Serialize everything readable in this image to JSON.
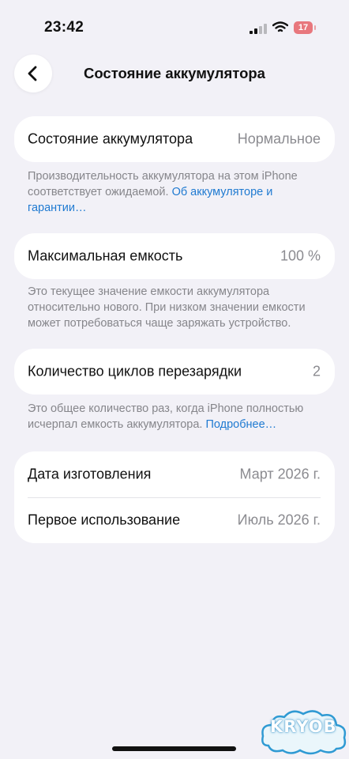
{
  "status_bar": {
    "time": "23:42",
    "battery_level": "17"
  },
  "header": {
    "title": "Состояние аккумулятора",
    "back_icon": "chevron-left-icon"
  },
  "battery_health": {
    "label": "Состояние аккумулятора",
    "value": "Нормальное",
    "footnote_text": "Производительность аккумулятора на этом iPhone соответствует ожидаемой. ",
    "footnote_link": "Об аккумуляторе и гарантии…"
  },
  "max_capacity": {
    "label": "Максимальная емкость",
    "value": "100 %",
    "footnote_text": "Это текущее значение емкости аккумулятора относительно нового. При низком значении емкости может потребоваться чаще заряжать устройство."
  },
  "cycle_count": {
    "label": "Количество циклов перезарядки",
    "value": "2",
    "footnote_text": "Это общее количество раз, когда iPhone полностью исчерпал емкость аккумулятора. ",
    "footnote_link": "Подробнее…"
  },
  "dates": {
    "manufacture_label": "Дата изготовления",
    "manufacture_value": "Март 2026 г.",
    "first_use_label": "Первое использование",
    "first_use_value": "Июль 2026 г."
  },
  "watermark": {
    "text": "KRYOB"
  },
  "colors": {
    "accent_link": "#1f7ad1",
    "background": "#f2f1f7",
    "battery_low": "#e8777d"
  }
}
